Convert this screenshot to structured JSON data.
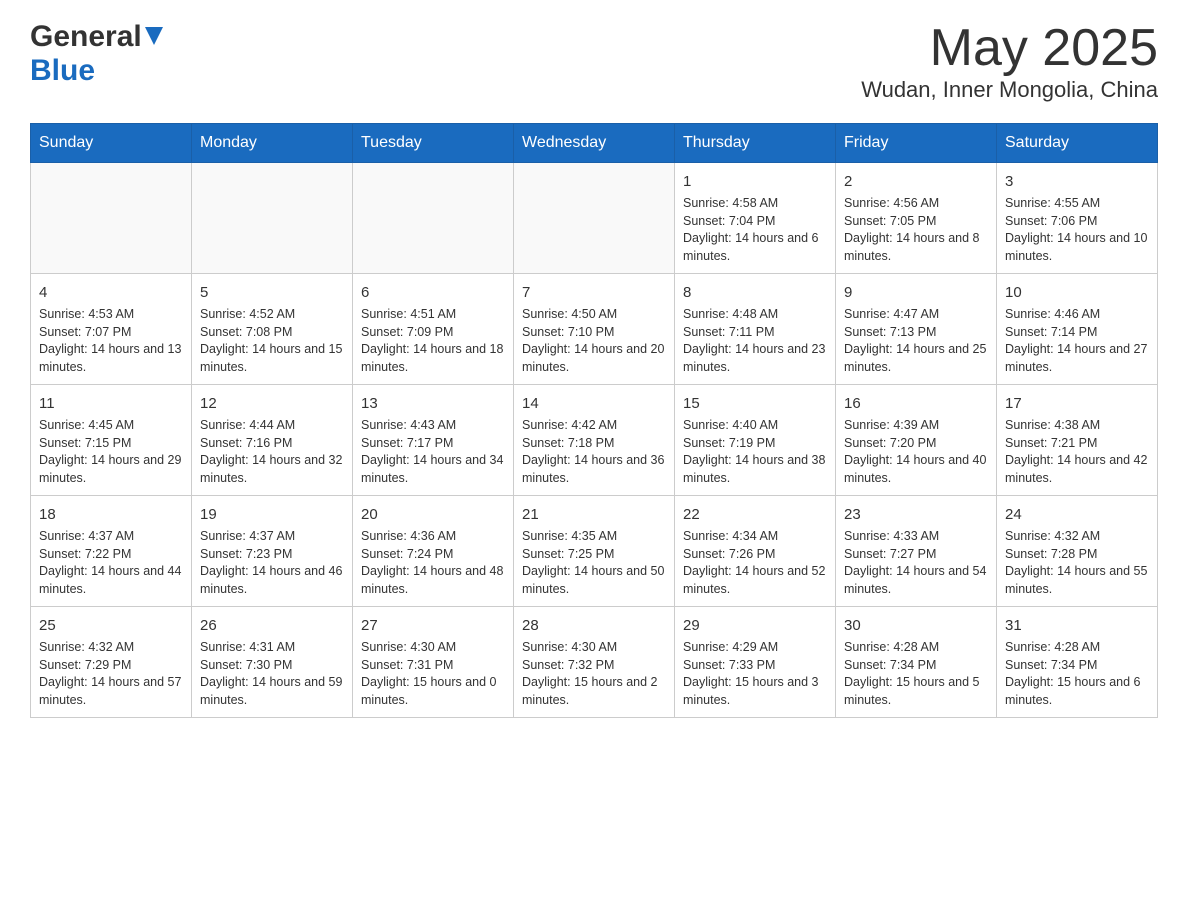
{
  "header": {
    "logo_general": "General",
    "logo_blue": "Blue",
    "month_year": "May 2025",
    "location": "Wudan, Inner Mongolia, China"
  },
  "weekdays": [
    "Sunday",
    "Monday",
    "Tuesday",
    "Wednesday",
    "Thursday",
    "Friday",
    "Saturday"
  ],
  "weeks": [
    [
      {
        "day": "",
        "info": ""
      },
      {
        "day": "",
        "info": ""
      },
      {
        "day": "",
        "info": ""
      },
      {
        "day": "",
        "info": ""
      },
      {
        "day": "1",
        "info": "Sunrise: 4:58 AM\nSunset: 7:04 PM\nDaylight: 14 hours and 6 minutes."
      },
      {
        "day": "2",
        "info": "Sunrise: 4:56 AM\nSunset: 7:05 PM\nDaylight: 14 hours and 8 minutes."
      },
      {
        "day": "3",
        "info": "Sunrise: 4:55 AM\nSunset: 7:06 PM\nDaylight: 14 hours and 10 minutes."
      }
    ],
    [
      {
        "day": "4",
        "info": "Sunrise: 4:53 AM\nSunset: 7:07 PM\nDaylight: 14 hours and 13 minutes."
      },
      {
        "day": "5",
        "info": "Sunrise: 4:52 AM\nSunset: 7:08 PM\nDaylight: 14 hours and 15 minutes."
      },
      {
        "day": "6",
        "info": "Sunrise: 4:51 AM\nSunset: 7:09 PM\nDaylight: 14 hours and 18 minutes."
      },
      {
        "day": "7",
        "info": "Sunrise: 4:50 AM\nSunset: 7:10 PM\nDaylight: 14 hours and 20 minutes."
      },
      {
        "day": "8",
        "info": "Sunrise: 4:48 AM\nSunset: 7:11 PM\nDaylight: 14 hours and 23 minutes."
      },
      {
        "day": "9",
        "info": "Sunrise: 4:47 AM\nSunset: 7:13 PM\nDaylight: 14 hours and 25 minutes."
      },
      {
        "day": "10",
        "info": "Sunrise: 4:46 AM\nSunset: 7:14 PM\nDaylight: 14 hours and 27 minutes."
      }
    ],
    [
      {
        "day": "11",
        "info": "Sunrise: 4:45 AM\nSunset: 7:15 PM\nDaylight: 14 hours and 29 minutes."
      },
      {
        "day": "12",
        "info": "Sunrise: 4:44 AM\nSunset: 7:16 PM\nDaylight: 14 hours and 32 minutes."
      },
      {
        "day": "13",
        "info": "Sunrise: 4:43 AM\nSunset: 7:17 PM\nDaylight: 14 hours and 34 minutes."
      },
      {
        "day": "14",
        "info": "Sunrise: 4:42 AM\nSunset: 7:18 PM\nDaylight: 14 hours and 36 minutes."
      },
      {
        "day": "15",
        "info": "Sunrise: 4:40 AM\nSunset: 7:19 PM\nDaylight: 14 hours and 38 minutes."
      },
      {
        "day": "16",
        "info": "Sunrise: 4:39 AM\nSunset: 7:20 PM\nDaylight: 14 hours and 40 minutes."
      },
      {
        "day": "17",
        "info": "Sunrise: 4:38 AM\nSunset: 7:21 PM\nDaylight: 14 hours and 42 minutes."
      }
    ],
    [
      {
        "day": "18",
        "info": "Sunrise: 4:37 AM\nSunset: 7:22 PM\nDaylight: 14 hours and 44 minutes."
      },
      {
        "day": "19",
        "info": "Sunrise: 4:37 AM\nSunset: 7:23 PM\nDaylight: 14 hours and 46 minutes."
      },
      {
        "day": "20",
        "info": "Sunrise: 4:36 AM\nSunset: 7:24 PM\nDaylight: 14 hours and 48 minutes."
      },
      {
        "day": "21",
        "info": "Sunrise: 4:35 AM\nSunset: 7:25 PM\nDaylight: 14 hours and 50 minutes."
      },
      {
        "day": "22",
        "info": "Sunrise: 4:34 AM\nSunset: 7:26 PM\nDaylight: 14 hours and 52 minutes."
      },
      {
        "day": "23",
        "info": "Sunrise: 4:33 AM\nSunset: 7:27 PM\nDaylight: 14 hours and 54 minutes."
      },
      {
        "day": "24",
        "info": "Sunrise: 4:32 AM\nSunset: 7:28 PM\nDaylight: 14 hours and 55 minutes."
      }
    ],
    [
      {
        "day": "25",
        "info": "Sunrise: 4:32 AM\nSunset: 7:29 PM\nDaylight: 14 hours and 57 minutes."
      },
      {
        "day": "26",
        "info": "Sunrise: 4:31 AM\nSunset: 7:30 PM\nDaylight: 14 hours and 59 minutes."
      },
      {
        "day": "27",
        "info": "Sunrise: 4:30 AM\nSunset: 7:31 PM\nDaylight: 15 hours and 0 minutes."
      },
      {
        "day": "28",
        "info": "Sunrise: 4:30 AM\nSunset: 7:32 PM\nDaylight: 15 hours and 2 minutes."
      },
      {
        "day": "29",
        "info": "Sunrise: 4:29 AM\nSunset: 7:33 PM\nDaylight: 15 hours and 3 minutes."
      },
      {
        "day": "30",
        "info": "Sunrise: 4:28 AM\nSunset: 7:34 PM\nDaylight: 15 hours and 5 minutes."
      },
      {
        "day": "31",
        "info": "Sunrise: 4:28 AM\nSunset: 7:34 PM\nDaylight: 15 hours and 6 minutes."
      }
    ]
  ]
}
